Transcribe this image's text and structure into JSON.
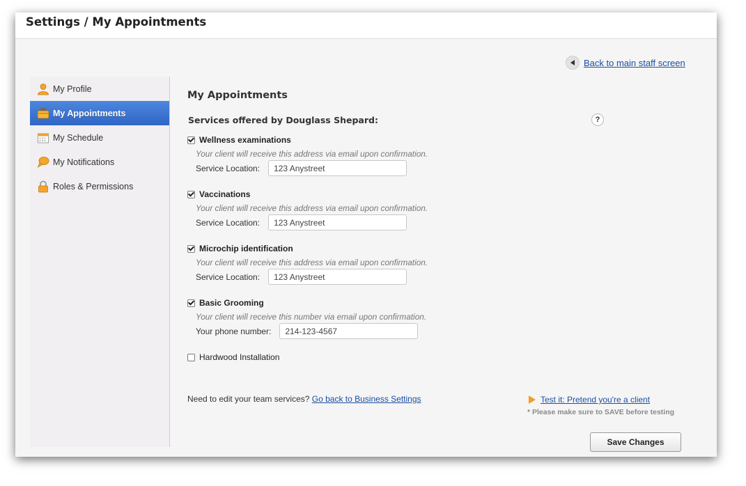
{
  "header": {
    "title": "Settings / My Appointments"
  },
  "back_link": {
    "label": "Back to main staff screen"
  },
  "sidebar": {
    "items": [
      {
        "label": "My Profile",
        "icon": "user-icon"
      },
      {
        "label": "My Appointments",
        "icon": "briefcase-icon",
        "active": true
      },
      {
        "label": "My Schedule",
        "icon": "calendar-icon"
      },
      {
        "label": "My Notifications",
        "icon": "speech-bubble-icon"
      },
      {
        "label": "Roles & Permissions",
        "icon": "lock-icon"
      }
    ]
  },
  "main": {
    "title": "My Appointments",
    "services_title": "Services offered by Douglass Shepard:",
    "help_label": "?",
    "services": [
      {
        "name": "Wellness examinations",
        "checked": true,
        "note": "Your client will receive this address via email upon confirmation.",
        "field_label": "Service Location:",
        "field_value": "123 Anystreet"
      },
      {
        "name": "Vaccinations",
        "checked": true,
        "note": "Your client will receive this address via email upon confirmation.",
        "field_label": "Service Location:",
        "field_value": "123 Anystreet"
      },
      {
        "name": "Microchip identification",
        "checked": true,
        "note": "Your client will receive this address via email upon confirmation.",
        "field_label": "Service Location:",
        "field_value": "123 Anystreet"
      },
      {
        "name": "Basic Grooming",
        "checked": true,
        "note": "Your client will receive this number via email upon confirmation.",
        "field_label": "Your phone number:",
        "field_value": "214-123-4567"
      },
      {
        "name": "Hardwood Installation",
        "checked": false
      }
    ],
    "footer_text": "Need to edit your team services?",
    "footer_link": "Go back to Business Settings",
    "test_link": "Test it: Pretend you're a client",
    "test_note": "* Please make sure to SAVE before testing",
    "save_label": "Save Changes"
  },
  "colors": {
    "accent": "#2f66c6",
    "link": "#1a4fa3",
    "play": "#f0a020"
  }
}
